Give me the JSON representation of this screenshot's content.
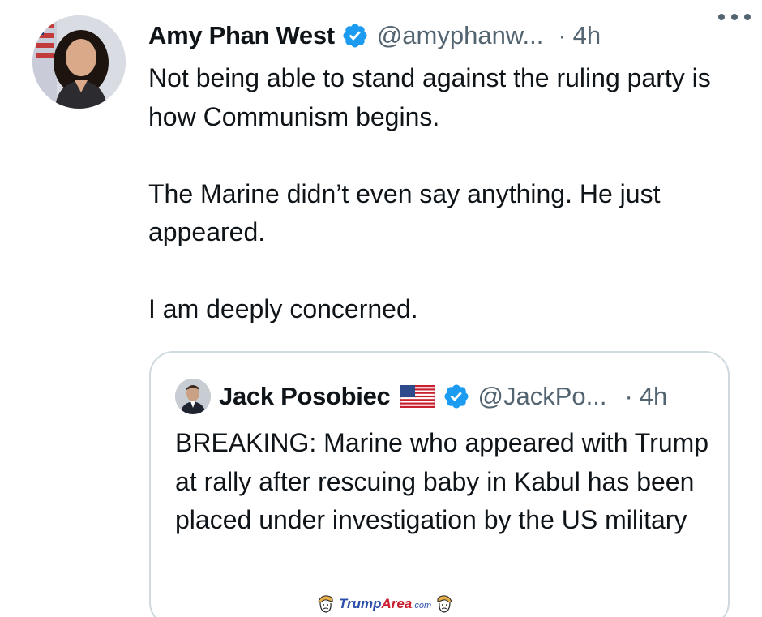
{
  "tweet": {
    "author_name": "Amy Phan West",
    "handle": "@amyphanw...",
    "separator": "·",
    "time": "4h",
    "paragraphs": [
      "Not being able to stand against the ruling party is how Communism begins.",
      "The Marine didn’t even say anything. He just appeared.",
      "I am deeply concerned."
    ],
    "icons": {
      "verified": "verified-badge-icon",
      "more": "more-options-icon"
    }
  },
  "quoted_tweet": {
    "author_name": "Jack Posobiec",
    "handle": "@JackPo...",
    "separator": "·",
    "time": "4h",
    "text": "BREAKING: Marine who appeared with Trump at rally after rescuing baby in Kabul has been placed under investigation by the US military",
    "icons": {
      "flag": "us-flag-icon",
      "verified": "verified-badge-icon"
    }
  },
  "watermark": {
    "part1": "Trump",
    "part2": "Area",
    "part3": ".com"
  },
  "colors": {
    "verified_blue": "#1d9bf0",
    "text_primary": "#0f1419",
    "text_secondary": "#536471",
    "border": "#cfd9de"
  }
}
